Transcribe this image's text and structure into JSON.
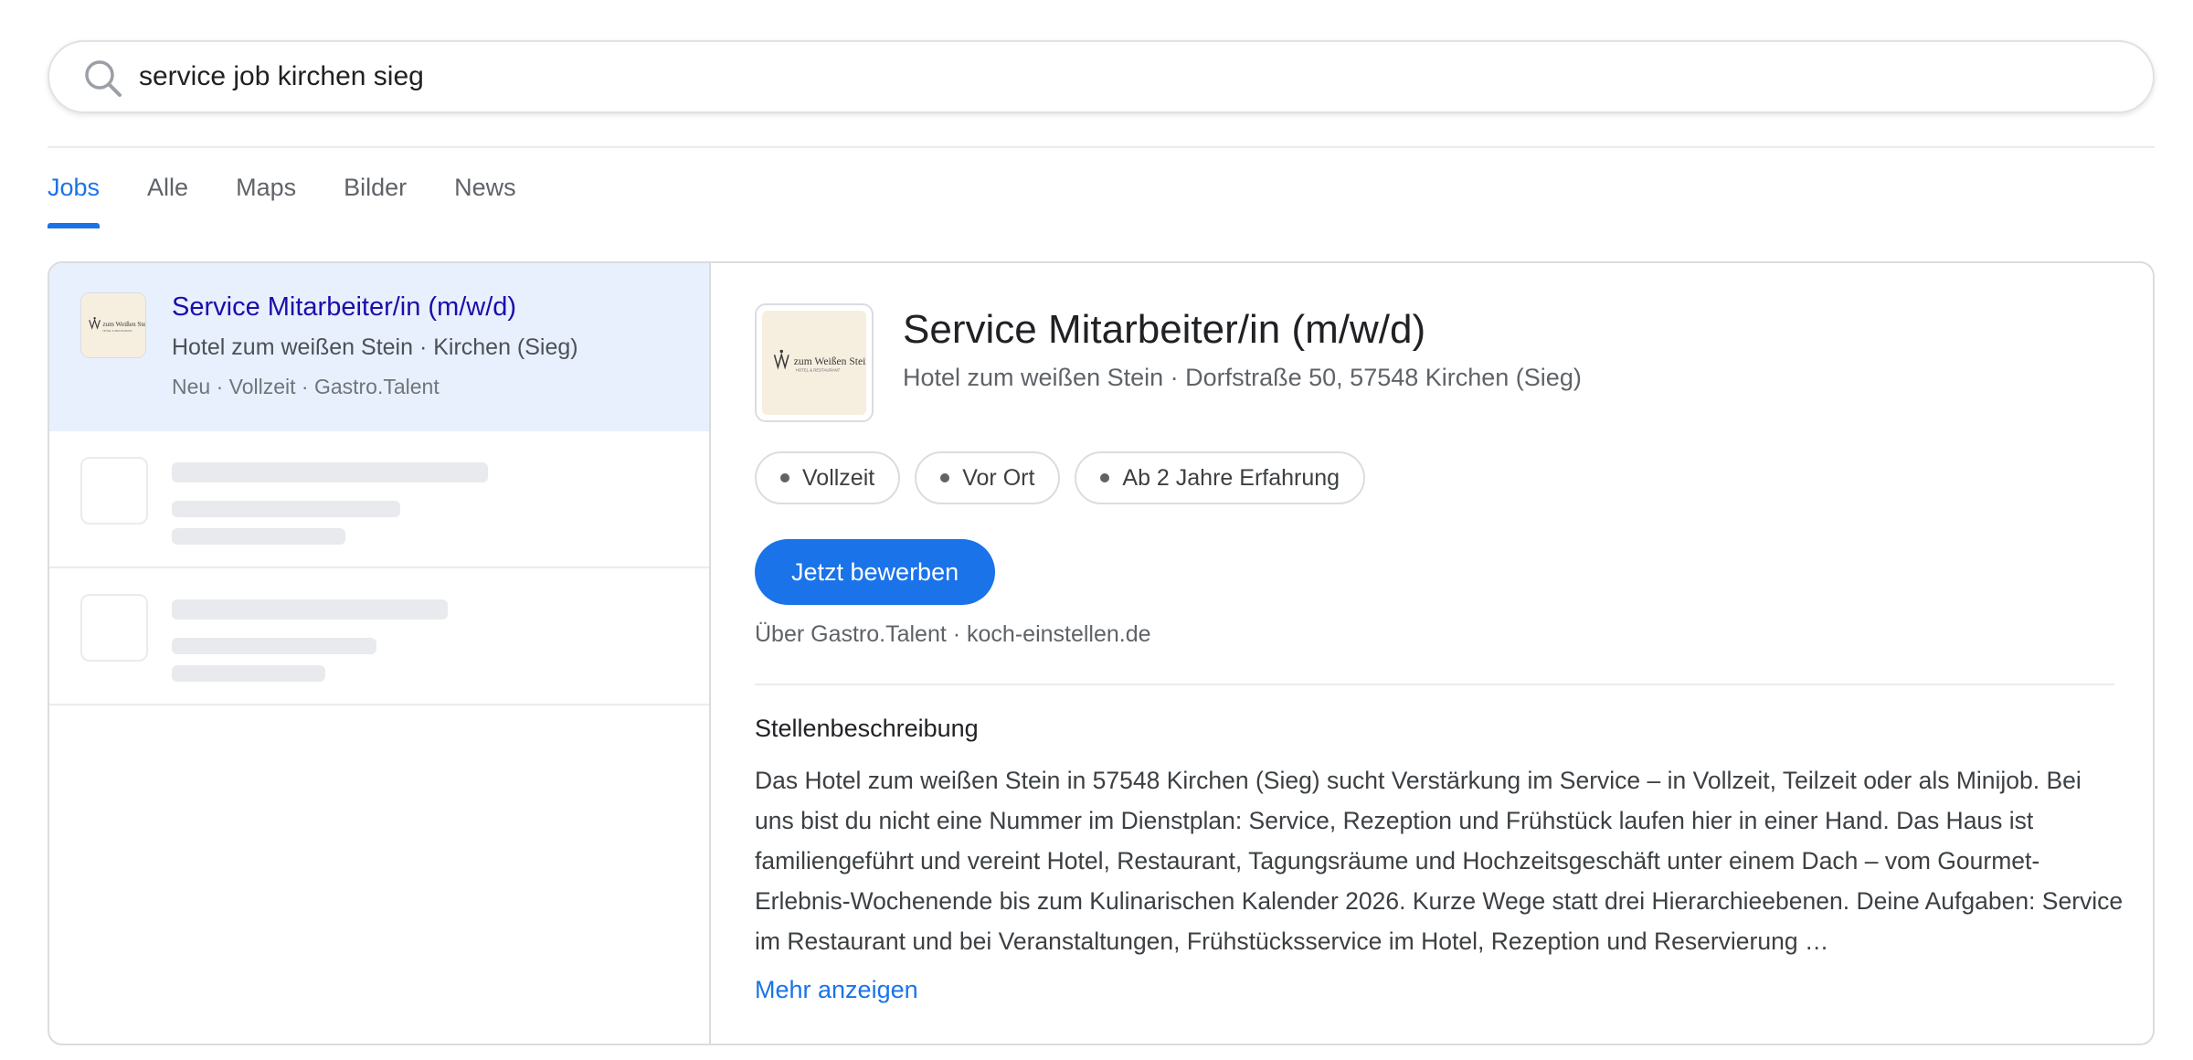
{
  "search": {
    "query": "service job kirchen sieg",
    "icon": "search-icon"
  },
  "tabs": [
    {
      "label": "Jobs",
      "active": true
    },
    {
      "label": "Alle",
      "active": false
    },
    {
      "label": "Maps",
      "active": false
    },
    {
      "label": "Bilder",
      "active": false
    },
    {
      "label": "News",
      "active": false
    }
  ],
  "results": {
    "selected": {
      "title": "Service Mitarbeiter/in (m/w/d)",
      "subtitle": "Hotel zum weißen Stein · Kirchen (Sieg)",
      "meta": "Neu · Vollzeit · Gastro.Talent",
      "logo_text": "zum Weißen Stein",
      "logo_subtext": "HOTEL & RESTAURANT"
    },
    "placeholders_count": 2
  },
  "detail": {
    "title": "Service Mitarbeiter/in (m/w/d)",
    "subtitle": "Hotel zum weißen Stein · Dorfstraße 50, 57548 Kirchen (Sieg)",
    "logo_text": "zum Weißen Stein",
    "logo_subtext": "HOTEL & RESTAURANT",
    "chips": [
      "Vollzeit",
      "Vor Ort",
      "Ab 2 Jahre Erfahrung"
    ],
    "apply_label": "Jetzt bewerben",
    "source": "Über Gastro.Talent · koch-einstellen.de",
    "section_title": "Stellenbeschreibung",
    "description": "Das Hotel zum weißen Stein in 57548 Kirchen (Sieg) sucht Verstärkung im Service – in Vollzeit, Teilzeit oder als Minijob. Bei uns bist du nicht eine Nummer im Dienstplan: Service, Rezeption und Frühstück laufen hier in einer Hand. Das Haus ist familiengeführt und vereint Hotel, Restaurant, Tagungsräume und Hochzeitsgeschäft unter einem Dach – vom Gourmet-Erlebnis-Wochenende bis zum Kulinarischen Kalender 2026. Kurze Wege statt drei Hierarchieebenen. Deine Aufgaben: Service im Restaurant und bei Veranstaltungen, Frühstücksservice im Hotel, Rezeption und Reservierung …",
    "more_label": "Mehr anzeigen"
  },
  "colors": {
    "accent": "#1a73e8",
    "link": "#1a0dab",
    "selected_bg": "#e8f0fe",
    "logo_bg": "#f6efe0"
  }
}
